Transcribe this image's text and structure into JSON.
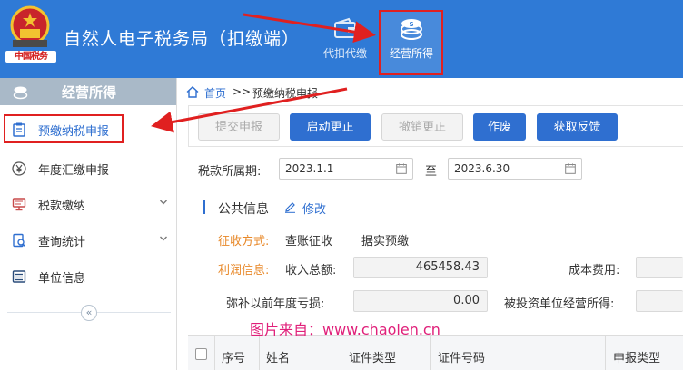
{
  "header": {
    "title": "自然人电子税务局（扣缴端）",
    "emblem_text": "中国税务",
    "nav": [
      {
        "label": "代扣代缴",
        "icon": "wallet-icon"
      },
      {
        "label": "经营所得",
        "icon": "coins-icon",
        "selected": true
      }
    ]
  },
  "sidebar": {
    "title": "经营所得",
    "items": [
      {
        "label": "预缴纳税申报",
        "icon": "clipboard-icon",
        "active": true
      },
      {
        "label": "年度汇缴申报",
        "icon": "yen-icon"
      },
      {
        "label": "税款缴纳",
        "icon": "monitor-icon",
        "expandable": true
      },
      {
        "label": "查询统计",
        "icon": "document-search-icon",
        "expandable": true
      },
      {
        "label": "单位信息",
        "icon": "list-icon"
      }
    ],
    "collapse_glyph": "«"
  },
  "breadcrumb": {
    "home": "首页",
    "separator": ">>",
    "current": "预缴纳税申报"
  },
  "toolbar": {
    "buttons": [
      {
        "label": "提交申报",
        "enabled": false
      },
      {
        "label": "启动更正",
        "enabled": true
      },
      {
        "label": "撤销更正",
        "enabled": false
      },
      {
        "label": "作废",
        "enabled": true
      },
      {
        "label": "获取反馈",
        "enabled": true
      }
    ]
  },
  "period": {
    "label": "税款所属期:",
    "start": "2023.1.1",
    "to": "至",
    "end": "2023.6.30"
  },
  "public_info": {
    "title": "公共信息",
    "edit": "修改",
    "collection_label": "征收方式:",
    "collection_value": "查账征收",
    "collection_detail": "据实预缴",
    "profit_label": "利润信息:",
    "revenue_label": "收入总额:",
    "revenue_value": "465458.43",
    "cost_label": "成本费用:",
    "loss_label": "弥补以前年度亏损:",
    "loss_value": "0.00",
    "invested_label": "被投资单位经营所得:"
  },
  "watermark": "图片来自：www.chaolen.cn",
  "table": {
    "columns": [
      "序号",
      "姓名",
      "证件类型",
      "证件号码",
      "申报类型"
    ]
  },
  "colors": {
    "header_bg": "#2f7ad6",
    "primary": "#2f6fd0",
    "highlight": "#e02020",
    "orange_label": "#e8892a",
    "watermark": "#e0207a"
  }
}
